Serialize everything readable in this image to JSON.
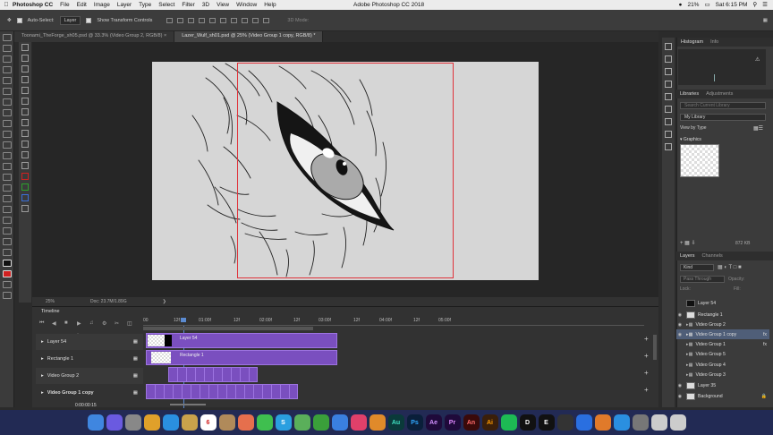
{
  "menubar": {
    "app_name": "Photoshop CC",
    "items": [
      "File",
      "Edit",
      "Image",
      "Layer",
      "Type",
      "Select",
      "Filter",
      "3D",
      "View",
      "Window",
      "Help"
    ],
    "window_title": "Adobe Photoshop CC 2018",
    "battery": "21%",
    "clock": "Sat 6:15 PM"
  },
  "options": {
    "auto_select_label": "Auto-Select:",
    "auto_select_value": "Layer",
    "transform_controls_label": "Show Transform Controls",
    "mode_3d": "3D Mode:"
  },
  "tabs": [
    {
      "label": "Toonami_TheForge_sh05.psd @ 33.3% (Video Group 2, RGB/8)"
    },
    {
      "label": "Lazer_Wulf_sh01.psd @ 25% (Video Group 1 copy, RGB/8) *"
    }
  ],
  "status": {
    "zoom": "25%",
    "doc": "Doc: 23.7M/1.89G"
  },
  "timeline": {
    "title": "Timeline",
    "timecode": "0:00:00:15",
    "ruler": [
      "00",
      "12f",
      "01:00f",
      "12f",
      "02:00f",
      "12f",
      "03:00f",
      "12f",
      "04:00f",
      "12f",
      "05:00f"
    ],
    "tracks": [
      {
        "name": "Layer 54",
        "clip": "Layer 54"
      },
      {
        "name": "Rectangle 1",
        "clip": "Rectangle 1"
      },
      {
        "name": "Video Group 2",
        "clip": ""
      },
      {
        "name": "Video Group 1 copy",
        "clip": ""
      }
    ]
  },
  "panels": {
    "histogram_tab": "Histogram",
    "info_tab": "Info",
    "libraries_tab": "Libraries",
    "adjustments_tab": "Adjustments",
    "lib_search_placeholder": "Search Current Library",
    "library_name": "My Library",
    "view_by": "View by Type",
    "graphics_header": "Graphics",
    "lib_size": "872 KB",
    "layers_tab": "Layers",
    "channels_tab": "Channels",
    "kind": "Kind",
    "blend": "Pass Through",
    "opacity_label": "Opacity:",
    "lock_label": "Lock:",
    "fill_label": "Fill:"
  },
  "layers": [
    {
      "name": "Layer 54",
      "selected": false
    },
    {
      "name": "Rectangle 1",
      "selected": false
    },
    {
      "name": "Video Group 2",
      "selected": false
    },
    {
      "name": "Video Group 1 copy",
      "selected": true
    },
    {
      "name": "Video Group 1",
      "selected": false
    },
    {
      "name": "Video Group 5",
      "selected": false
    },
    {
      "name": "Video Group 4",
      "selected": false
    },
    {
      "name": "Video Group 3",
      "selected": false
    },
    {
      "name": "Layer 35",
      "selected": false
    },
    {
      "name": "Background",
      "selected": false
    }
  ],
  "dock": [
    {
      "icon": "finder-icon",
      "color": "#3f86e0",
      "glyph": ""
    },
    {
      "icon": "siri-icon",
      "color": "#6a5ae0",
      "glyph": ""
    },
    {
      "icon": "launchpad-icon",
      "color": "#888888",
      "glyph": ""
    },
    {
      "icon": "chrome-icon",
      "color": "#e0a02a",
      "glyph": ""
    },
    {
      "icon": "safari-icon",
      "color": "#2a8fe0",
      "glyph": ""
    },
    {
      "icon": "notes-icon",
      "color": "#c9a24b",
      "glyph": ""
    },
    {
      "icon": "calendar-icon",
      "color": "#ffffff",
      "glyph": "6"
    },
    {
      "icon": "contacts-icon",
      "color": "#b08a5a",
      "glyph": ""
    },
    {
      "icon": "photos-icon",
      "color": "#e66f4d",
      "glyph": ""
    },
    {
      "icon": "facetime-icon",
      "color": "#3fbf4f",
      "glyph": ""
    },
    {
      "icon": "skype-icon",
      "color": "#2a9fe0",
      "glyph": "S"
    },
    {
      "icon": "maps-icon",
      "color": "#5aaf5a",
      "glyph": ""
    },
    {
      "icon": "numbers-icon",
      "color": "#3a9f3a",
      "glyph": ""
    },
    {
      "icon": "keynote-icon",
      "color": "#3a7fdf",
      "glyph": ""
    },
    {
      "icon": "itunes-icon",
      "color": "#e0406a",
      "glyph": ""
    },
    {
      "icon": "books-icon",
      "color": "#e08a2a",
      "glyph": ""
    },
    {
      "icon": "audition-icon",
      "color": "#0a3a3a",
      "glyph": "Au"
    },
    {
      "icon": "photoshop-icon",
      "color": "#0a1f3a",
      "glyph": "Ps"
    },
    {
      "icon": "aftereffects-icon",
      "color": "#1f0a3a",
      "glyph": "Ae"
    },
    {
      "icon": "premiere-icon",
      "color": "#1f0a3a",
      "glyph": "Pr"
    },
    {
      "icon": "animate-icon",
      "color": "#3a0a0a",
      "glyph": "An"
    },
    {
      "icon": "illustrator-icon",
      "color": "#3a1f0a",
      "glyph": "Ai"
    },
    {
      "icon": "spotify-icon",
      "color": "#1db954",
      "glyph": ""
    },
    {
      "icon": "app-d-icon",
      "color": "#111111",
      "glyph": "D"
    },
    {
      "icon": "app-e-icon",
      "color": "#111111",
      "glyph": "E"
    },
    {
      "icon": "app-x-icon",
      "color": "#333333",
      "glyph": ""
    },
    {
      "icon": "app-blue-icon",
      "color": "#2a6fe0",
      "glyph": ""
    },
    {
      "icon": "app-orange-icon",
      "color": "#e07a2a",
      "glyph": ""
    },
    {
      "icon": "appstore-icon",
      "color": "#2a8fe0",
      "glyph": ""
    },
    {
      "icon": "preferences-icon",
      "color": "#777777",
      "glyph": ""
    },
    {
      "icon": "downloads-icon",
      "color": "#cccccc",
      "glyph": ""
    },
    {
      "icon": "trash-icon",
      "color": "#cccccc",
      "glyph": ""
    }
  ]
}
